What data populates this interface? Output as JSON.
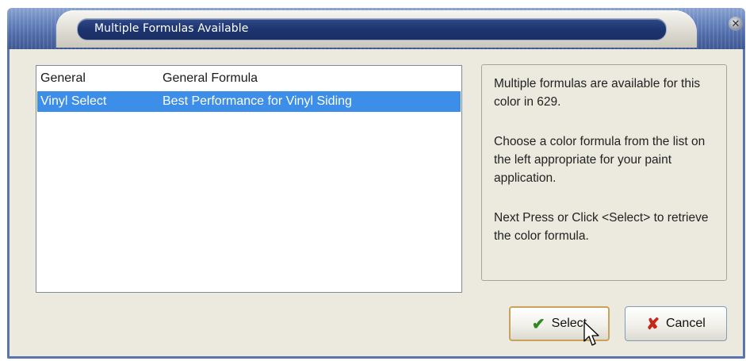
{
  "window": {
    "title": "Multiple Formulas Available",
    "close_glyph": "✕",
    "close_icon": "close-icon"
  },
  "formula_list": {
    "rows": [
      {
        "name": "General",
        "description": "General Formula",
        "selected": false
      },
      {
        "name": "Vinyl Select",
        "description": "Best Performance for Vinyl Siding",
        "selected": true
      }
    ]
  },
  "info_panel": {
    "para1": "Multiple formulas are available for this color in 629.",
    "para2": "Choose a color formula from the list on the left appropriate for your paint application.",
    "para3": "Next Press or Click <Select> to retrieve the color formula."
  },
  "buttons": {
    "select_label": "Select",
    "select_icon": "check-icon",
    "cancel_label": "Cancel",
    "cancel_icon": "x-icon"
  },
  "colors": {
    "selection": "#3d8ee8",
    "title_bar": "#4e6aa8",
    "check_green": "#2f8a24",
    "cancel_red": "#c4281c"
  }
}
